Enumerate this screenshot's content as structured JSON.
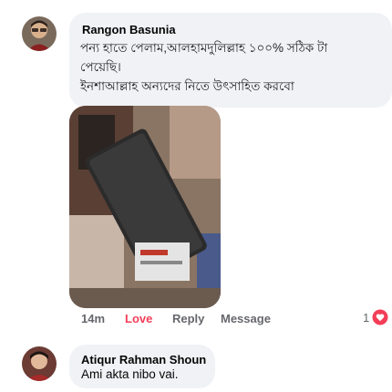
{
  "comments": [
    {
      "author": "Rangon Basunia",
      "lines": [
        "পন্য হাতে পেলাম,আলহামদুলিল্লাহ ১০০% সঠিক টা",
        "পেয়েছি।",
        "ইনশাআল্লাহ অন্যদের নিতে উৎসাহিত করবো"
      ]
    },
    {
      "author": "Atiqur Rahman Shoun",
      "text": "Ami akta nibo vai."
    }
  ],
  "actions": {
    "time": "14m",
    "reaction": "Love",
    "reply": "Reply",
    "message": "Message",
    "reaction_count": "1"
  },
  "colors": {
    "bubble": "#f0f2f5",
    "love": "#f33e58",
    "muted": "#65676b"
  }
}
